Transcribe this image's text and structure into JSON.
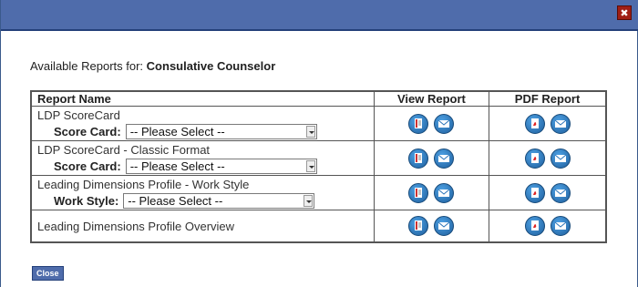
{
  "dialog": {
    "close_symbol": "✖",
    "heading_label": "Available Reports for:",
    "heading_name": "Consulative Counselor",
    "close_button": "Close"
  },
  "table": {
    "headers": [
      "Report Name",
      "View Report",
      "PDF Report"
    ],
    "rows": [
      {
        "name": "LDP ScoreCard",
        "select_label": "Score Card:",
        "select_value": "-- Please Select --"
      },
      {
        "name": "LDP ScoreCard - Classic Format",
        "select_label": "Score Card:",
        "select_value": "-- Please Select --"
      },
      {
        "name": "Leading Dimensions Profile - Work Style",
        "select_label": "Work Style:",
        "select_value": "-- Please Select --"
      },
      {
        "name": "Leading Dimensions Profile Overview"
      }
    ]
  },
  "icons": {
    "view": "view-report-icon",
    "pdf": "pdf-icon",
    "email": "email-icon"
  },
  "colors": {
    "titlebar": "#4f6cab",
    "close_x": "#a01e14",
    "icon_blue": "#2a73b8"
  }
}
